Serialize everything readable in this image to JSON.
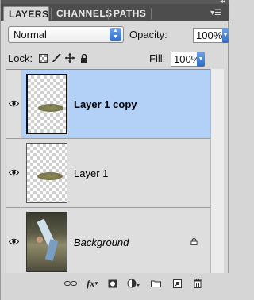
{
  "tabs": [
    {
      "label": "LAYERS"
    },
    {
      "label": "CHANNELS"
    },
    {
      "label": "PATHS"
    }
  ],
  "blend_mode": {
    "value": "Normal"
  },
  "opacity": {
    "label": "Opacity:",
    "value": "100%"
  },
  "fill": {
    "label": "Fill:",
    "value": "100%"
  },
  "lock": {
    "label": "Lock:"
  },
  "layers": [
    {
      "name": "Layer 1 copy",
      "selected": true,
      "visible": true
    },
    {
      "name": "Layer 1",
      "selected": false,
      "visible": true
    },
    {
      "name": "Background",
      "selected": false,
      "visible": true,
      "locked": true
    }
  ],
  "footer": {
    "fx_label": "fx"
  },
  "colors": {
    "selection": "#b3d1f7",
    "tab_bar": "#4d4d4d",
    "panel": "#d9d9d9"
  }
}
